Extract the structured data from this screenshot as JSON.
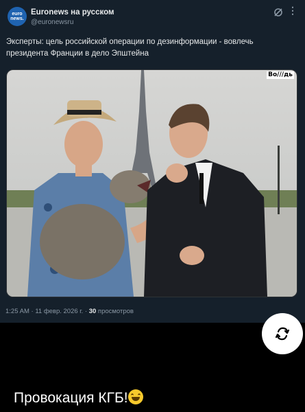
{
  "post": {
    "author": "Euronews на русском",
    "handle": "@euronewsru",
    "avatar_line1": "euro",
    "avatar_line2": "news.",
    "text": "Эксперты: цель российской операции по дезинформации - вовлечь президента Франции в дело Эпштейна",
    "media_watermark": "Bo///дь",
    "time": "1:25 AM",
    "date": "11 февр. 2026 г.",
    "views_count": "30",
    "views_label": "просмотров"
  },
  "caption": "Провокация КГБ!",
  "colors": {
    "card_bg": "#15202b",
    "page_bg": "#000000",
    "avatar_bg": "#1f63b0"
  }
}
